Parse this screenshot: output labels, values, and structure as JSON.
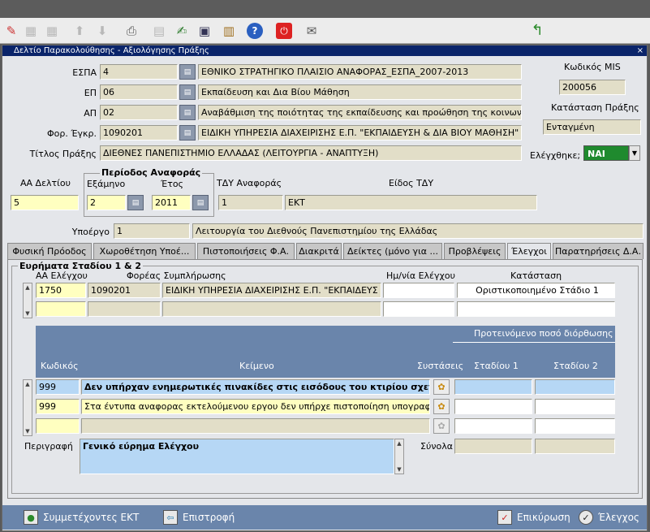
{
  "toolbar": {
    "icons": [
      "edit-icon",
      "new-record-icon",
      "copy-icon",
      "up-icon",
      "down-icon",
      "print-icon",
      "print-preview-icon",
      "edit-note-icon",
      "save-icon",
      "paste-icon",
      "help-icon",
      "exit-icon",
      "attach-icon",
      "back-arrow-icon"
    ]
  },
  "window": {
    "title": "Δελτίο Παρακολούθησης - Αξιολόγησης Πράξης",
    "close": "×"
  },
  "header": {
    "espa_label": "ΕΣΠΑ",
    "espa_code": "4",
    "espa_desc": "ΕΘΝΙΚΟ ΣΤΡΑΤΗΓΙΚΟ ΠΛΑΙΣΙΟ ΑΝΑΦΟΡΑΣ_ΕΣΠΑ_2007-2013",
    "ep_label": "ΕΠ",
    "ep_code": "06",
    "ep_desc": "Εκπαίδευση και Δια Βίου Μάθηση",
    "ap_label": "ΑΠ",
    "ap_code": "02",
    "ap_desc": "Αναβάθμιση της ποιότητας της εκπαίδευσης και προώθηση της κοινωνική",
    "foreas_label": "Φορ. Έγκρ.",
    "foreas_code": "1090201",
    "foreas_desc": "ΕΙΔΙΚΗ ΥΠΗΡΕΣΙΑ ΔΙΑΧΕΙΡΙΣΗΣ Ε.Π. \"ΕΚΠΑΙΔΕΥΣΗ & ΔΙΑ ΒΙΟΥ ΜΑΘΗΣΗ\"",
    "title_label": "Τίτλος Πράξης",
    "title_value": "ΔΙΕΘΝΕΣ ΠΑΝΕΠΙΣΤΗΜΙΟ ΕΛΛΑΔΑΣ (ΛΕΙΤΟΥΡΓΙΑ - ΑΝΑΠΤΥΞΗ)",
    "mis_label": "Κωδικός MIS",
    "mis_value": "200056",
    "status_label": "Κατάσταση Πράξης",
    "status_value": "Ενταγμένη",
    "checked_label": "Ελέγχθηκε;",
    "checked_value": "ΝΑΙ"
  },
  "period": {
    "aa_label": "ΑΑ Δελτίου",
    "aa_value": "5",
    "group_title": "Περίοδος Αναφοράς",
    "semester_label": "Εξάμηνο",
    "semester_value": "2",
    "year_label": "Έτος",
    "year_value": "2011",
    "tdy_label": "ΤΔΥ Αναφοράς",
    "tdy_value": "1",
    "tdy_kind_label": "Είδος ΤΔΥ",
    "tdy_kind_value": "ΕΚΤ",
    "subproject_label": "Υποέργο",
    "subproject_code": "1",
    "subproject_desc": "Λειτουργία του Διεθνούς Πανεπιστημίου της Ελλάδας"
  },
  "tabs": [
    "Φυσική Πρόοδος",
    "Χωροθέτηση Υποέ...",
    "Πιστοποιήσεις Φ.Α.",
    "Διακριτά",
    "Δείκτες (μόνο για ...",
    "Προβλέψεις",
    "Έλεγχοι",
    "Παρατηρήσεις Δ.Α."
  ],
  "findings": {
    "group_title": "Ευρήματα Σταδίου 1 & 2",
    "col_aa": "ΑΑ Ελέγχου",
    "col_foreas": "Φορέας Συμπλήρωσης",
    "col_date": "Ημ/νία Ελέγχου",
    "col_status": "Κατάσταση",
    "row1": {
      "aa": "1750",
      "code": "1090201",
      "foreas": "ΕΙΔΙΚΗ ΥΠΗΡΕΣΙΑ ΔΙΑΧΕΙΡΙΣΗΣ Ε.Π. \"ΕΚΠΑΙΔΕΥΣ",
      "date": "",
      "status": "Οριστικοποιημένο Στάδιο 1"
    }
  },
  "items": {
    "proposed_label": "Προτεινόμενο ποσό διόρθωσης",
    "col_code": "Κωδικός",
    "col_text": "Κείμενο",
    "col_recommend": "Συστάσεις",
    "col_stage1": "Σταδίου 1",
    "col_stage2": "Σταδίου 2",
    "rows": [
      {
        "code": "999",
        "text": "Δεν υπήρχαν ενημερωτικές πινακίδες στις εισόδους του κτιρίου  σχετικά με τ"
      },
      {
        "code": "999",
        "text": "Στα έντυπα αναφορας εκτελούμενου εργου δεν υπήρχε πιστοποίηση υπογραφής"
      },
      {
        "code": "",
        "text": ""
      }
    ],
    "desc_label": "Περιγραφή",
    "desc_value": "Γενικό εύρημα Ελέγχου",
    "totals_label": "Σύνολα"
  },
  "bottom": {
    "participants": "Συμμετέχοντες ΕΚΤ",
    "back": "Επιστροφή",
    "confirm": "Επικύρωση",
    "check": "Έλεγχος"
  }
}
